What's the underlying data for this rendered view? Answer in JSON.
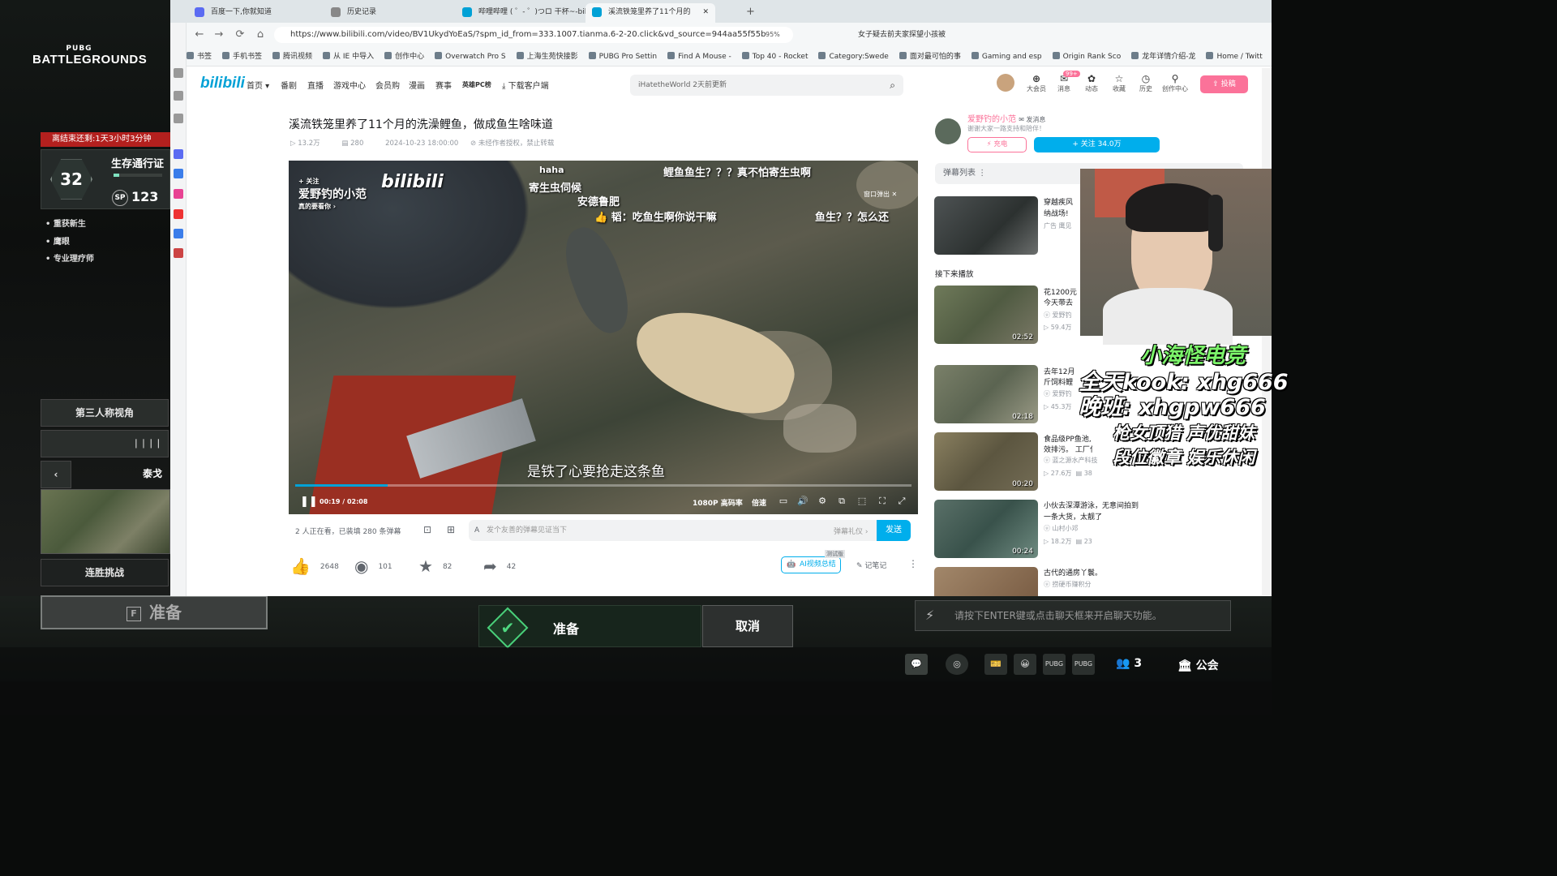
{
  "game": {
    "logo_small": "PUBG",
    "logo_big": "BATTLEGROUNDS",
    "season_timer": "离结束还剩:1天3小时3分钟",
    "pass_title": "生存通行证",
    "pass_level": "32",
    "pass_progress": 0.12,
    "sp_label": "SP",
    "sp_value": "123",
    "missions": [
      "重获新生",
      "鹰眼",
      "专业理疗师"
    ],
    "perspective": "第三人称视角",
    "squad_icons": "ᛁᛁᛁᛁ",
    "map_name": "泰戈",
    "streak": "连胜挑战",
    "ready_key": "F",
    "ready_left": "准备",
    "ready_label": "准备",
    "ready_check": "✔",
    "cancel_label": "取消",
    "chat_hint": "请按下ENTER键或点击聊天框来开启聊天功能。",
    "friends_count": "3",
    "guild_label": "公会",
    "taskbar_icons": [
      "💬",
      "◎",
      "🎫",
      "😀",
      "PUBG",
      "PUBG"
    ]
  },
  "browser": {
    "tabs": [
      {
        "label": "百度一下,你就知道"
      },
      {
        "label": "历史记录"
      },
      {
        "label": "哔哩哔哩 ( ゜- ゜)つロ 干杯~-bili"
      },
      {
        "label": "溪流铁笼里养了11个月的"
      }
    ],
    "url": "https://www.bilibili.com/video/BV1UkydYoEaS/?spm_id_from=333.1007.tianma.6-2-20.click&vd_source=944aa55f55b",
    "zoom": "95%",
    "url_search": "女子疑去前夫家探望小孩被",
    "bookmarks": [
      "书签",
      "手机书签",
      "腾讯视频",
      "从 IE 中导入",
      "创作中心",
      "Overwatch Pro S",
      "上海生苑快接影",
      "PUBG Pro Settin",
      "Find A Mouse -",
      "Top 40 - Rocket",
      "Category:Swede",
      "面对最可怕的事",
      "Gaming and esp",
      "Origin Rank Sco",
      "龙年详情介绍-龙",
      "Home / Twitt"
    ]
  },
  "bili": {
    "logo": "bilibili",
    "nav": [
      "首页 ▾",
      "番剧",
      "直播",
      "游戏中心",
      "会员购",
      "漫画",
      "赛事",
      "英雄PC榜",
      "⤓ 下载客户端"
    ],
    "search_placeholder": "iHatetheWorld 2天前更新",
    "header_icons": [
      {
        "icon": "⊕",
        "label": "大会员"
      },
      {
        "icon": "✉",
        "label": "消息"
      },
      {
        "icon": "✿",
        "label": "动态"
      },
      {
        "icon": "☆",
        "label": "收藏"
      },
      {
        "icon": "◷",
        "label": "历史"
      },
      {
        "icon": "⚲",
        "label": "创作中心"
      }
    ],
    "message_badge": "99+",
    "upload_label": "⇪ 投稿"
  },
  "video": {
    "title": "溪流铁笼里养了11个月的洗澡鲤鱼，做成鱼生啥味道",
    "views": "13.2万",
    "danmaku_count": "280",
    "date": "2024-10-23 18:00:00",
    "copyright": "未经作者授权，禁止转载",
    "up_tag": "爱野钓的小范",
    "up_tag_sub": "真的要看你 ›",
    "follow_small": "+ 关注",
    "popout": "窗口弹出",
    "danmaku": [
      "鲤鱼鱼生？？？真不怕寄生虫啊",
      "haha",
      "寄生虫伺候",
      "安德鲁肥",
      "👍 韬：吃鱼生啊你说干嘛",
      "鱼生？？怎么还"
    ],
    "subtitle": "是铁了心要抢走这条鱼",
    "time": "00:19 / 02:08",
    "progress": 0.15,
    "quality": "1080P 高码率",
    "speed": "倍速",
    "viewers": "2 人正在看，已装填 280 条弹幕",
    "dm_placeholder": "发个友善的弹幕见证当下",
    "dm_etiquette": "弹幕礼仪 ›",
    "send": "发送",
    "likes": "2648",
    "coins": "101",
    "favs": "82",
    "shares": "42",
    "ai_summary": "AI视频总结",
    "beta": "测试版",
    "notes": "记笔记"
  },
  "up": {
    "name": "爱野钓的小范",
    "message": "✉ 发消息",
    "desc": "谢谢大家一路支持和陪伴！",
    "charge": "⚡ 充电",
    "follow": "+ 关注 34.0万"
  },
  "sidebar": {
    "danmaku_list": "弹幕列表  ⋮",
    "ad_title": "穿越疾风",
    "ad_title2": "纳战场!",
    "ad_sub": "广告 鹰见",
    "next_label": "接下来播放",
    "recs": [
      {
        "title": "花1200元",
        "title2": "今天带去",
        "author": "爱野钓",
        "views": "59.4万",
        "duration": "02:52"
      },
      {
        "title": "去年12月",
        "title2": "斤饲料鲤",
        "author": "爱野钓",
        "views": "45.3万",
        "duration": "02:18"
      },
      {
        "title": "食品级PP鱼池,",
        "title2": "效排污。 工厂化",
        "author": "蓝之源水产科技",
        "views": "27.6万",
        "comments": "38",
        "duration": "00:20"
      },
      {
        "title": "小伙去深潭游泳，无意间拍到",
        "title2": "一条大货，太靓了",
        "author": "山村小邓",
        "views": "18.2万",
        "comments": "23",
        "duration": "00:24"
      },
      {
        "title": "古代的通房丫鬟。",
        "author": "捞硬币赚积分"
      }
    ]
  },
  "overlay": {
    "title": "小海怪电竞",
    "kook": "全天kook: xhg666",
    "vx": "晚班: xhgpw666",
    "tag1": "枪女顶猎 声优甜妹",
    "tag2": "段位徽章 娱乐休闲"
  }
}
